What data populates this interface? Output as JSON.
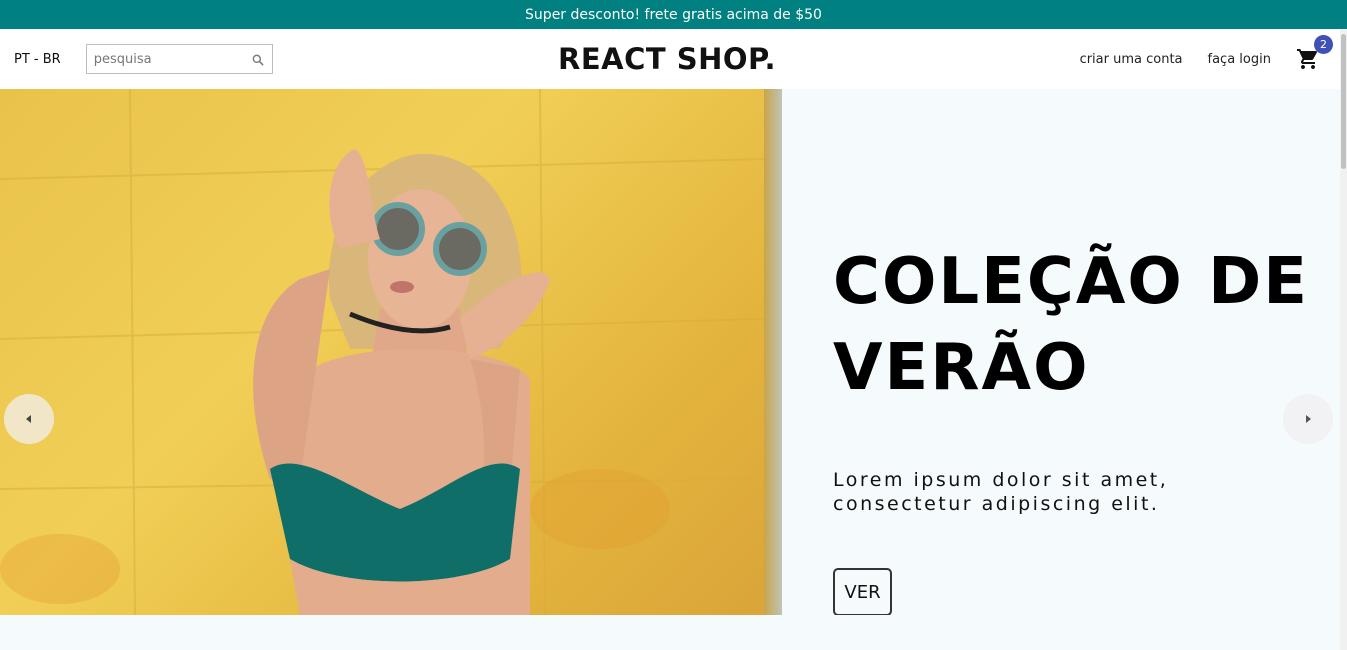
{
  "announcement": {
    "text": "Super desconto! frete gratis acima de $50"
  },
  "navbar": {
    "language": "PT - BR",
    "search": {
      "placeholder": "pesquisa",
      "value": "",
      "icon": "search-icon"
    },
    "logo": "REACT SHOP.",
    "links": [
      {
        "label": "criar uma conta"
      },
      {
        "label": "faça login"
      }
    ],
    "cart": {
      "icon": "shopping-cart-icon",
      "count": "2"
    }
  },
  "slider": {
    "slide": {
      "title": "COLEÇÃO DE VERÃO",
      "description": "Lorem ipsum dolor sit amet, consectetur adipiscing elit.",
      "button_label": "VER",
      "background": "#f5fafd"
    },
    "arrows": {
      "left_icon": "arrow-left-icon",
      "right_icon": "arrow-right-icon"
    }
  },
  "colors": {
    "announcement_bg": "#008080",
    "badge_bg": "#3f51b5",
    "accent_yellow": "#f0c94e"
  }
}
